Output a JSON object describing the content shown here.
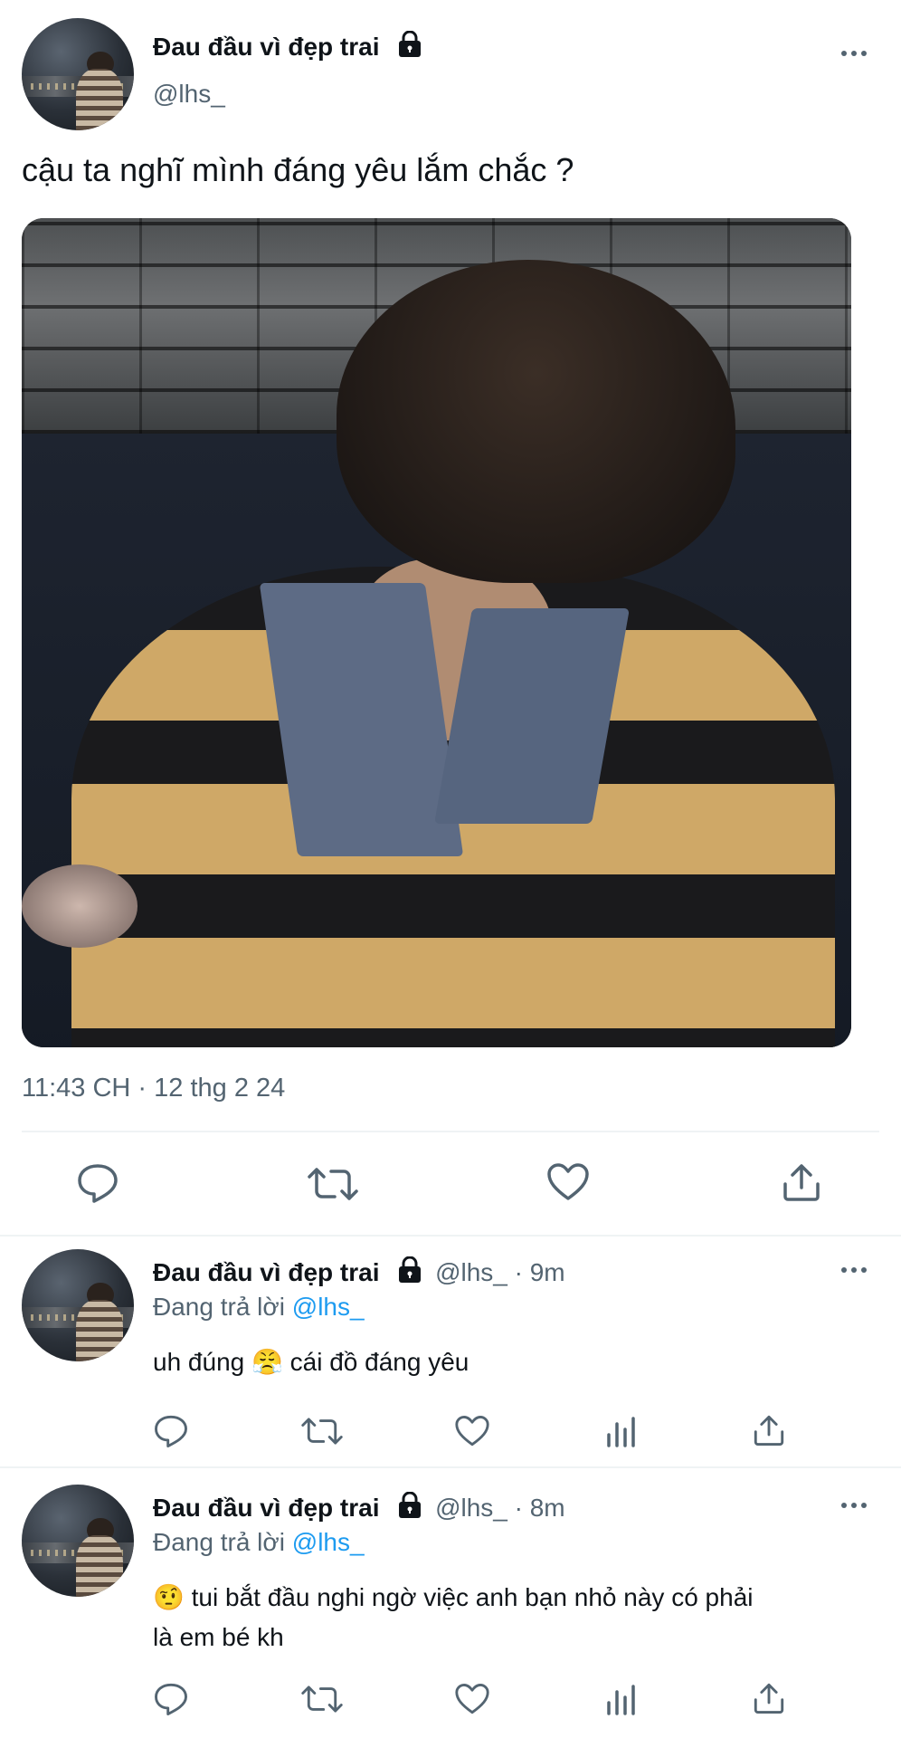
{
  "main_tweet": {
    "display_name": "Đau đầu vì đẹp trai",
    "handle": "@lhs_",
    "text": "cậu ta nghĩ mình đáng yêu lắm chắc ?",
    "timestamp": "11:43 CH · 12 thg 2 24"
  },
  "replies": [
    {
      "display_name": "Đau đầu vì đẹp trai",
      "meta": "@lhs_ · 9m",
      "reply_prefix": "Đang trả lời ",
      "reply_mention": "@lhs_",
      "emoji": "😤",
      "text_before": "uh đúng ",
      "text_after": " cái đồ đáng yêu"
    },
    {
      "display_name": "Đau đầu vì đẹp trai",
      "meta": "@lhs_ · 8m",
      "reply_prefix": "Đang trả lời ",
      "reply_mention": "@lhs_",
      "emoji": "🤨",
      "line1": " tui bắt đầu nghi ngờ việc anh bạn nhỏ này có phải",
      "line2": "là em bé kh"
    }
  ],
  "colors": {
    "text": "#0f1419",
    "secondary": "#536471",
    "accent": "#1d9bf0",
    "divider": "#eff3f4"
  },
  "icons": [
    "lock-icon",
    "more-icon",
    "reply-icon",
    "retweet-icon",
    "like-icon",
    "views-icon",
    "share-icon"
  ]
}
